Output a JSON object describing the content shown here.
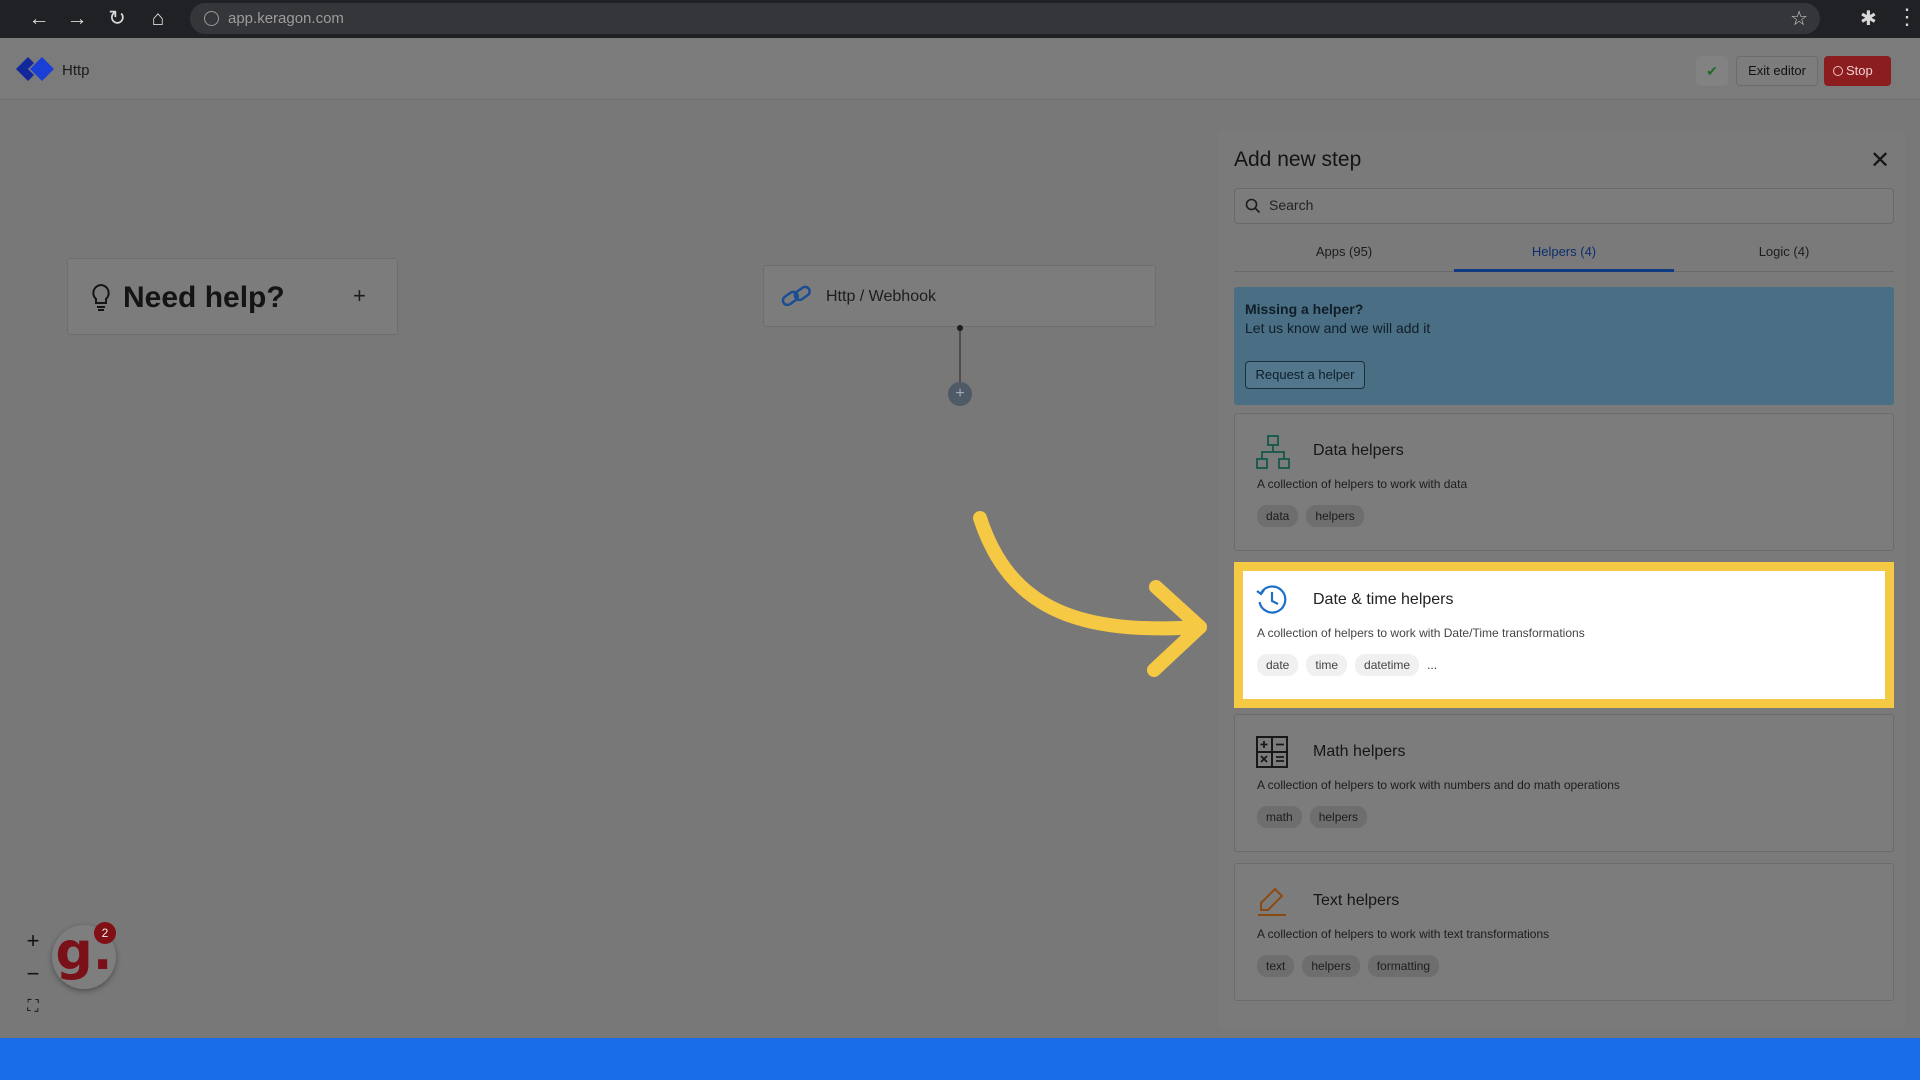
{
  "browser": {
    "url": "app.keragon.com",
    "icons": [
      "back-arrow-icon",
      "forward-arrow-icon",
      "reload-icon",
      "home-icon",
      "globe-icon",
      "star-icon",
      "puzzle-icon",
      "kebab-menu-icon"
    ]
  },
  "header": {
    "flow_name": "Http",
    "check_icon": "check-icon",
    "exit_label": "Exit editor",
    "stop_label": "Stop"
  },
  "canvas": {
    "help_title": "Need help?",
    "help_plus": "+",
    "trigger_label": "Http / Webhook",
    "add_step_symbol": "+",
    "zoom_in": "+",
    "zoom_out": "−",
    "fit_view": "⛶",
    "avatar_letter": "g.",
    "avatar_badge": "2"
  },
  "panel": {
    "title": "Add new step",
    "close": "✕",
    "search_placeholder": "Search",
    "tabs": [
      {
        "label": "Apps (95)",
        "active": false
      },
      {
        "label": "Helpers (4)",
        "active": true
      },
      {
        "label": "Logic (4)",
        "active": false
      }
    ],
    "missing": {
      "title": "Missing a helper?",
      "text": "Let us know and we will add it",
      "button": "Request a helper"
    },
    "helpers": [
      {
        "title": "Data helpers",
        "icon": "network-icon",
        "desc": "A collection of helpers to work with data",
        "tags": [
          "data",
          "helpers"
        ],
        "more": ""
      },
      {
        "title": "Date & time helpers",
        "icon": "clock-icon",
        "desc": "A collection of helpers to work with Date/Time transformations",
        "tags": [
          "date",
          "time",
          "datetime"
        ],
        "more": "..."
      },
      {
        "title": "Math helpers",
        "icon": "calculator-icon",
        "desc": "A collection of helpers to work with numbers and do math operations",
        "tags": [
          "math",
          "helpers"
        ],
        "more": ""
      },
      {
        "title": "Text helpers",
        "icon": "pencil-icon",
        "desc": "A collection of helpers to work with text transformations",
        "tags": [
          "text",
          "helpers",
          "formatting"
        ],
        "more": ""
      }
    ]
  },
  "colors": {
    "highlight": "#f6c944",
    "brand": "#1a3fd6",
    "stop": "#8b1d1f",
    "bottom_bar": "#1a6de8"
  }
}
